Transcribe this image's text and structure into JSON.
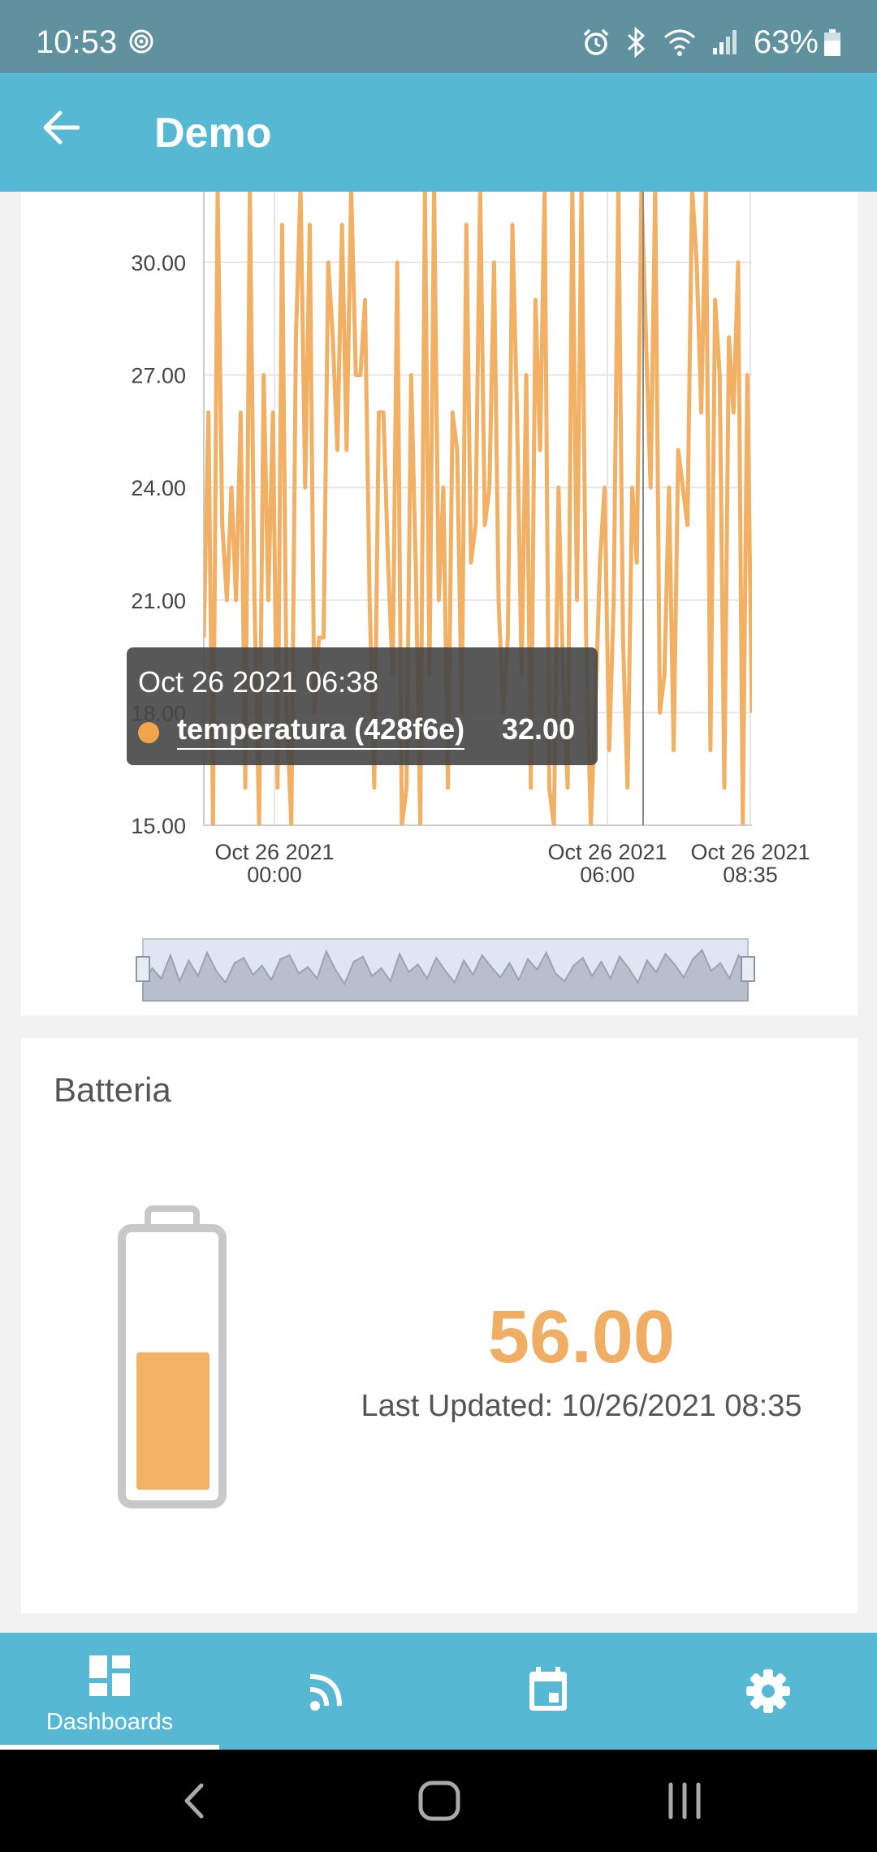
{
  "status_bar": {
    "time": "10:53",
    "battery_percent": "63%",
    "icons": [
      "cast-icon",
      "alarm-icon",
      "bluetooth-icon",
      "wifi-icon",
      "signal-icon",
      "battery-icon"
    ]
  },
  "app_bar": {
    "title": "Demo",
    "back_icon": "arrow-left-icon"
  },
  "chart_data": {
    "type": "line",
    "y_ticks": [
      "30.00",
      "27.00",
      "24.00",
      "21.00",
      "18.00",
      "15.00"
    ],
    "ylim": [
      15,
      32
    ],
    "x_ticks": [
      {
        "line1": "Oct 26 2021",
        "line2": "00:00"
      },
      {
        "line1": "Oct 26 2021",
        "line2": "06:00"
      },
      {
        "line1": "Oct 26 2021",
        "line2": "08:35"
      }
    ],
    "series": [
      {
        "name": "temperatura (428f6e)",
        "color": "#f2b065",
        "values": [
          20,
          26,
          15,
          32,
          23,
          21,
          24,
          21,
          26,
          16,
          32,
          21,
          15,
          27,
          21,
          26,
          16,
          31,
          18,
          15,
          28,
          32,
          24,
          31,
          18,
          20,
          20,
          30,
          28,
          25,
          31,
          25,
          32,
          27,
          27,
          29,
          21,
          16,
          26,
          26,
          22,
          19,
          30,
          15,
          16,
          27,
          22,
          15,
          32,
          19,
          32,
          21,
          24,
          16,
          26,
          25,
          18,
          31,
          22,
          23,
          32,
          23,
          24,
          30,
          21,
          18,
          20,
          31,
          26,
          19,
          27,
          16,
          29,
          25,
          32,
          16,
          15,
          24,
          19,
          16,
          32,
          21,
          32,
          20,
          15,
          18,
          22,
          24,
          17,
          21,
          32,
          20,
          16,
          24,
          22,
          32,
          28,
          24,
          32,
          18,
          19,
          24,
          17,
          25,
          24,
          23,
          32,
          30,
          26,
          32,
          17,
          29,
          27,
          16,
          28,
          26,
          30,
          15,
          27,
          18
        ]
      }
    ],
    "tooltip": {
      "date": "Oct 26 2021 06:38",
      "series": "temperatura (428f6e)",
      "value": "32.00"
    },
    "navigator_values": [
      8,
      20,
      12,
      30,
      10,
      26,
      14,
      32,
      18,
      9,
      24,
      28,
      15,
      22,
      11,
      27,
      30,
      16,
      21,
      12,
      33,
      19,
      8,
      25,
      29,
      14,
      20,
      10,
      31,
      17,
      23,
      12,
      28,
      18,
      9,
      26,
      15,
      30,
      21,
      13,
      24,
      11,
      27,
      19,
      32,
      16,
      10,
      22,
      28,
      14,
      25,
      12,
      29,
      20,
      9,
      26,
      17,
      31,
      23,
      13,
      27,
      34,
      18,
      24,
      12,
      30,
      21
    ]
  },
  "battery_card": {
    "title": "Batteria",
    "value": "56.00",
    "level": 0.56,
    "updated": "Last Updated: 10/26/2021 08:35",
    "fill_color": "#f0b264"
  },
  "bottom_nav": {
    "items": [
      {
        "label": "Dashboards",
        "icon": "dashboard-icon",
        "active": true
      },
      {
        "label": "",
        "icon": "rss-feed-icon",
        "active": false
      },
      {
        "label": "",
        "icon": "calendar-icon",
        "active": false
      },
      {
        "label": "",
        "icon": "settings-gear-icon",
        "active": false
      }
    ]
  },
  "system_nav": {
    "buttons": [
      "back-icon",
      "home-icon",
      "recents-icon"
    ]
  }
}
